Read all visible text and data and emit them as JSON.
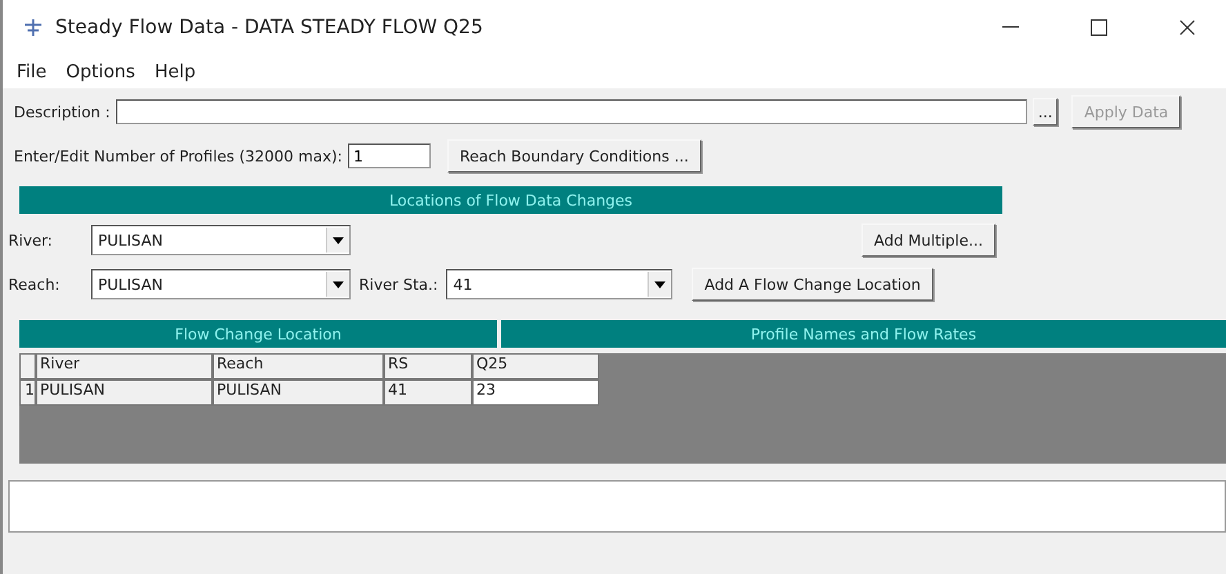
{
  "window": {
    "title": "Steady Flow Data - DATA STEADY FLOW Q25"
  },
  "menu": [
    "File",
    "Options",
    "Help"
  ],
  "description": {
    "label": "Description :",
    "more_button": "...",
    "apply_button": {
      "label": "Apply Data",
      "disabled": true
    }
  },
  "profiles": {
    "label": "Enter/Edit Number of Profiles (32000 max):",
    "value": "1",
    "button": "Reach Boundary Conditions ..."
  },
  "locations": {
    "title": "Locations of Flow Data Changes",
    "river_label": "River:",
    "river_value": "PULISAN",
    "reach_label": "Reach:",
    "reach_value": "PULISAN",
    "station_label": "River Sta.:",
    "station_value": "41",
    "add_multiple": "Add Multiple...",
    "add_location": "Add A Flow Change Location"
  },
  "table": {
    "left_title": "Flow Change Location",
    "right_title": "Profile Names and Flow Rates",
    "columns": [
      "River",
      "Reach",
      "RS",
      "Q25"
    ],
    "rows": [
      {
        "index": "1",
        "river": "PULISAN",
        "reach": "PULISAN",
        "rs": "41",
        "q25": "23"
      }
    ]
  }
}
